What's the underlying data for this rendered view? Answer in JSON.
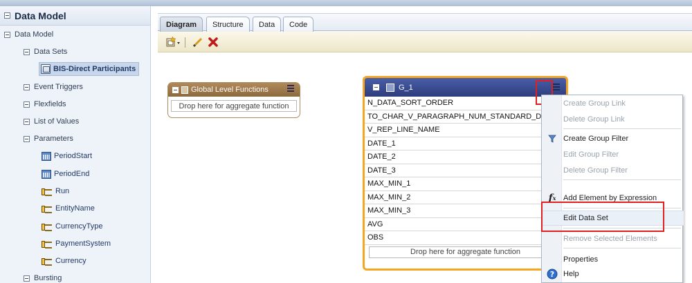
{
  "left_panel": {
    "title": "Data Model",
    "tree": {
      "root": "Data Model",
      "data_sets": "Data Sets",
      "selected_dataset": "BIS-Direct Participants",
      "event_triggers": "Event Triggers",
      "flexfields": "Flexfields",
      "list_of_values": "List of Values",
      "parameters": "Parameters",
      "params": [
        "PeriodStart",
        "PeriodEnd",
        "Run",
        "EntityName",
        "CurrencyType",
        "PaymentSystem",
        "Currency"
      ],
      "bursting": "Bursting"
    }
  },
  "tabs": [
    "Diagram",
    "Structure",
    "Data",
    "Code"
  ],
  "active_tab": "Diagram",
  "global_level_functions": {
    "title": "Global Level Functions",
    "drop_hint": "Drop here for aggregate function"
  },
  "group": {
    "name": "G_1",
    "columns": [
      "N_DATA_SORT_ORDER",
      "TO_CHAR_V_PARAGRAPH_NUM_STANDARD_DOC_",
      "V_REP_LINE_NAME",
      "DATE_1",
      "DATE_2",
      "DATE_3",
      "MAX_MIN_1",
      "MAX_MIN_2",
      "MAX_MIN_3",
      "AVG",
      "OBS"
    ],
    "drop_hint": "Drop here for aggregate function"
  },
  "context_menu": {
    "items": [
      {
        "label": "Create Group Link",
        "enabled": false,
        "icon": ""
      },
      {
        "label": "Delete Group Link",
        "enabled": false,
        "icon": ""
      },
      {
        "label": "Create Group Filter",
        "enabled": true,
        "icon": "filter-icon"
      },
      {
        "label": "Edit Group Filter",
        "enabled": false,
        "icon": ""
      },
      {
        "label": "Delete Group Filter",
        "enabled": false,
        "icon": ""
      },
      {
        "label": "Add Element by Expression",
        "enabled": true,
        "icon": "function-icon"
      },
      {
        "label": "Edit Data Set",
        "enabled": true,
        "icon": ""
      },
      {
        "label": "Remove Selected Elements",
        "enabled": false,
        "icon": ""
      },
      {
        "label": "Properties",
        "enabled": true,
        "icon": ""
      },
      {
        "label": "Help",
        "enabled": true,
        "icon": "help-icon"
      }
    ]
  },
  "colors": {
    "group_header": "#2d3c7c",
    "group_border": "#f5a623",
    "glf_header": "#9a7748",
    "highlight_box": "#e02020"
  }
}
